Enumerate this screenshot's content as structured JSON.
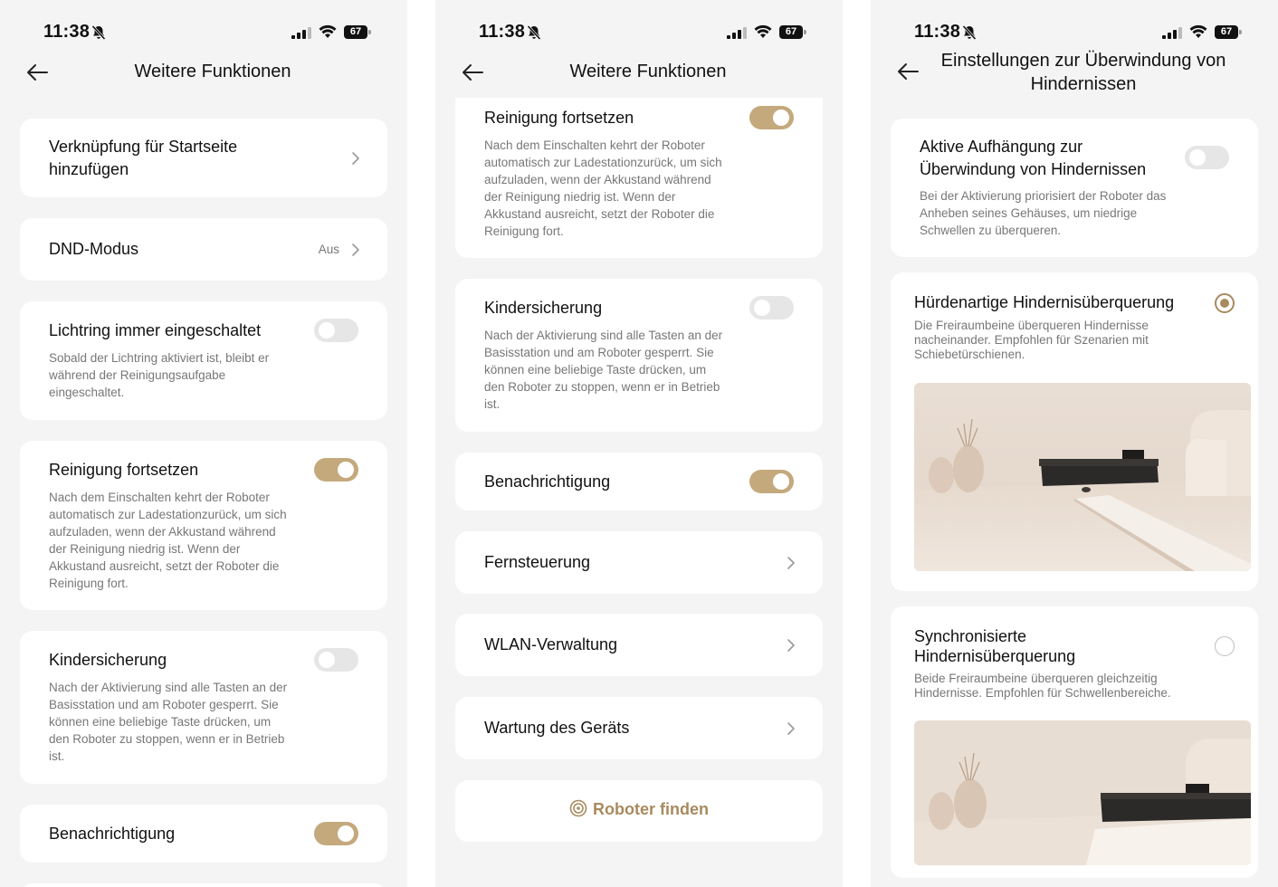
{
  "status": {
    "time": "11:38",
    "battery": "67"
  },
  "screen1": {
    "title": "Weitere Funktionen",
    "shortcut": {
      "label": "Verknüpfung für Startseite hinzufügen"
    },
    "dnd": {
      "label": "DND-Modus",
      "value": "Aus"
    },
    "light": {
      "label": "Lichtring immer eingeschaltet",
      "desc": "Sobald der Lichtring aktiviert ist, bleibt er während der Reinigungsaufgabe eingeschaltet.",
      "on": false
    },
    "resume": {
      "label": "Reinigung fortsetzen",
      "desc": "Nach dem Einschalten kehrt der Roboter automatisch zur Ladestationzurück, um sich aufzuladen, wenn der Akkustand während der Reinigung niedrig ist. Wenn der Akkustand ausreicht, setzt der Roboter die Reinigung fort.",
      "on": true
    },
    "childlock": {
      "label": "Kindersicherung",
      "desc": "Nach der Aktivierung sind alle Tasten an der Basisstation und am Roboter gesperrt. Sie können eine beliebige Taste drücken, um den Roboter zu stoppen, wenn er in Betrieb ist.",
      "on": false
    },
    "notify": {
      "label": "Benachrichtigung",
      "on": true
    }
  },
  "screen2": {
    "title": "Weitere Funktionen",
    "resume": {
      "label": "Reinigung fortsetzen",
      "desc": "Nach dem Einschalten kehrt der Roboter automatisch zur Ladestationzurück, um sich aufzuladen, wenn der Akkustand während der Reinigung niedrig ist. Wenn der Akkustand ausreicht, setzt der Roboter die Reinigung fort.",
      "on": true
    },
    "childlock": {
      "label": "Kindersicherung",
      "desc": "Nach der Aktivierung sind alle Tasten an der Basisstation und am Roboter gesperrt. Sie können eine beliebige Taste drücken, um den Roboter zu stoppen, wenn er in Betrieb ist.",
      "on": false
    },
    "notify": {
      "label": "Benachrichtigung",
      "on": true
    },
    "remote": {
      "label": "Fernsteuerung"
    },
    "wlan": {
      "label": "WLAN-Verwaltung"
    },
    "maintenance": {
      "label": "Wartung des Geräts"
    },
    "find": {
      "label": "Roboter finden"
    }
  },
  "screen3": {
    "title": "Einstellungen zur Überwindung von Hindernissen",
    "suspension": {
      "label": "Aktive Aufhängung zur Überwindung von Hindernissen",
      "desc": "Bei der Aktivierung priorisiert der Roboter das Anheben seines Gehäuses, um niedrige Schwellen zu überqueren.",
      "on": false
    },
    "hurdle": {
      "label": "Hürdenartige Hindernisüberquerung",
      "desc": "Die Freiraumbeine überqueren Hindernisse nacheinander. Empfohlen für Szenarien mit Schiebetürschienen.",
      "selected": true
    },
    "sync": {
      "label": "Synchronisierte Hindernisüberquerung",
      "desc": "Beide Freiraumbeine überqueren gleichzeitig Hindernisse. Empfohlen für Schwellenbereiche.",
      "selected": false
    }
  },
  "colors": {
    "accent": "#c4a97d",
    "accent_dark": "#a88a5e",
    "toggle_off": "#e6e6e6",
    "background": "#f4f4f4"
  }
}
